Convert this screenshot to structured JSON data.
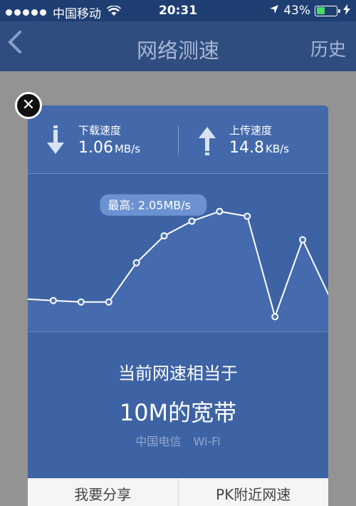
{
  "status_bar": {
    "carrier": "中国移动",
    "time": "20:31",
    "battery": "43%",
    "battery_level": 0.43,
    "icons": [
      "signal-dots-icon",
      "wifi-icon",
      "location-arrow-icon",
      "battery-icon",
      "charging-bolt-icon"
    ]
  },
  "navbar": {
    "title": "网络测速",
    "right_action": "历史",
    "back_icon": "chevron-left-icon"
  },
  "speed_card": {
    "download": {
      "label": "下载速度",
      "value": "1.06",
      "unit": "MB/s",
      "icon": "download-arrow-icon"
    },
    "upload": {
      "label": "上传速度",
      "value": "14.8",
      "unit": "KB/s",
      "icon": "upload-arrow-icon"
    },
    "peak_label": "最高: 2.05MB/s",
    "equivalent_text": "当前网速相当于",
    "bandwidth": "10M的宽带",
    "network_provider": "中国电信",
    "network_type": "Wi-Fi",
    "share_button": "我要分享",
    "pk_button": "PK附近网速",
    "close_icon": "close-x-icon"
  },
  "chart_data": {
    "type": "line",
    "title": "",
    "x": [
      0,
      1,
      2,
      3,
      4,
      5,
      6,
      7,
      8,
      9,
      10,
      11
    ],
    "values": [
      0.26,
      0.23,
      0.2,
      0.2,
      1.0,
      1.55,
      1.85,
      2.05,
      1.95,
      -0.1,
      1.47,
      0.27
    ],
    "ylim": [
      -0.4,
      2.8
    ],
    "markers": true,
    "peak_index": 7,
    "colors": {
      "line": "#ffffff",
      "fill": "#4a72b6",
      "bubble": "#6c92d1"
    }
  },
  "colors": {
    "status_bar": "#1f3f73",
    "navbar": "#2f4d7e",
    "card": "#3e63a4",
    "battery_fill": "#4cd964"
  }
}
